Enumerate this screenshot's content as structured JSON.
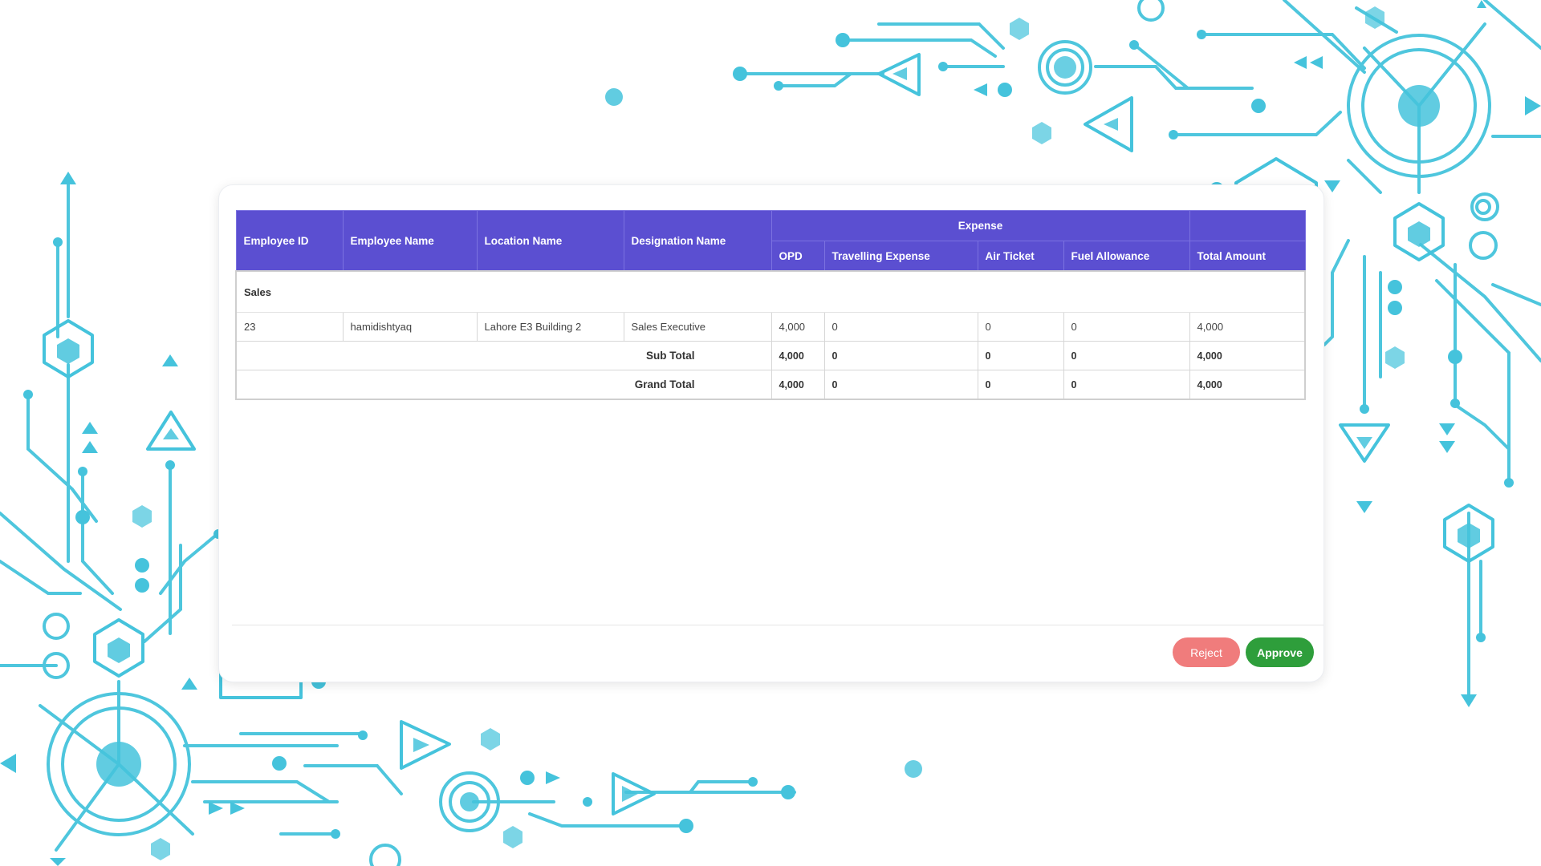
{
  "colors": {
    "header_bg": "#5b4fd1",
    "reject": "#f07c7c",
    "approve": "#2e9e3b",
    "circuit": "#45c3dc"
  },
  "table": {
    "headers": {
      "employee_id": "Employee ID",
      "employee_name": "Employee Name",
      "location_name": "Location Name",
      "designation_name": "Designation Name",
      "expense_group": "Expense",
      "opd": "OPD",
      "travelling_expense": "Travelling Expense",
      "air_ticket": "Air Ticket",
      "fuel_allowance": "Fuel Allowance",
      "total_amount": "Total Amount"
    },
    "group": "Sales",
    "rows": [
      {
        "employee_id": "23",
        "employee_name": "hamidishtyaq",
        "location_name": "Lahore E3 Building 2",
        "designation_name": "Sales Executive",
        "opd": "4,000",
        "travelling_expense": "0",
        "air_ticket": "0",
        "fuel_allowance": "0",
        "total_amount": "4,000"
      }
    ],
    "sub_total": {
      "label": "Sub Total",
      "opd": "4,000",
      "travelling_expense": "0",
      "air_ticket": "0",
      "fuel_allowance": "0",
      "total_amount": "4,000"
    },
    "grand_total": {
      "label": "Grand Total",
      "opd": "4,000",
      "travelling_expense": "0",
      "air_ticket": "0",
      "fuel_allowance": "0",
      "total_amount": "4,000"
    }
  },
  "actions": {
    "reject_label": "Reject",
    "approve_label": "Approve"
  }
}
